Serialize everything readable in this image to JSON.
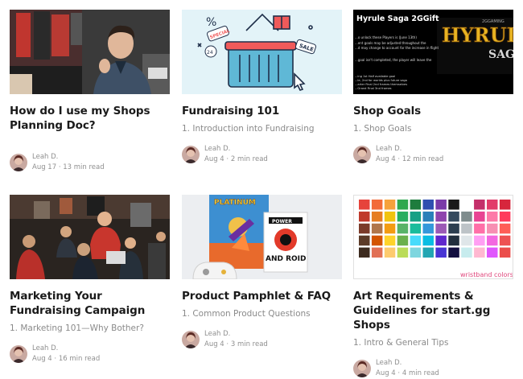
{
  "cards": [
    {
      "title": "How do I use my Shops Planning Doc?",
      "subtitle": "",
      "author": "Leah D.",
      "date": "Aug 17",
      "read": "13 min read"
    },
    {
      "title": "Fundraising 101",
      "subtitle": "1. Introduction into Fundraising",
      "author": "Leah D.",
      "date": "Aug 4",
      "read": "2 min read"
    },
    {
      "title": "Shop Goals",
      "subtitle": "1. Shop Goals",
      "author": "Leah D.",
      "date": "Aug 4",
      "read": "12 min read"
    },
    {
      "title": "Marketing Your Fundraising Campaign",
      "subtitle": "1. Marketing 101—Why Bother?",
      "author": "Leah D.",
      "date": "Aug 4",
      "read": "16 min read"
    },
    {
      "title": "Product Pamphlet & FAQ",
      "subtitle": "1. Common Product Questions",
      "author": "Leah D.",
      "date": "Aug 4",
      "read": "3 min read"
    },
    {
      "title": "Art Requirements & Guidelines for start.gg Shops",
      "subtitle": "1. Intro & General Tips",
      "author": "Leah D.",
      "date": "Aug 4",
      "read": "4 min read"
    }
  ],
  "thumbs": {
    "fund_tags": {
      "special": "SPECIAL",
      "sale": "SALE",
      "pct": "%",
      "num": "24"
    },
    "hyrule": {
      "heading": "Hyrule Saga 2GGift",
      "lines": [
        "...o unlock these Players is (June 13th)",
        "...ent goals may be adjusted throughout the",
        "...d may change to account for the increase in flight",
        "...goal isn't completed, the player will leave the",
        "...ing 1st Half available goal",
        "...le, 2nd for worlds plus future saga",
        "...arter Final 2nd frames themselves",
        "...Grand Final 3nd frames"
      ],
      "brand": "2GGAMING",
      "logo": "HYRULE",
      "logo2": "SAGA"
    },
    "pamphlet": {
      "game_title": "PLATINUM",
      "box_label": "AND ROID",
      "box_top": "POWER"
    },
    "swatch": {
      "caption": "wristband colors"
    }
  }
}
